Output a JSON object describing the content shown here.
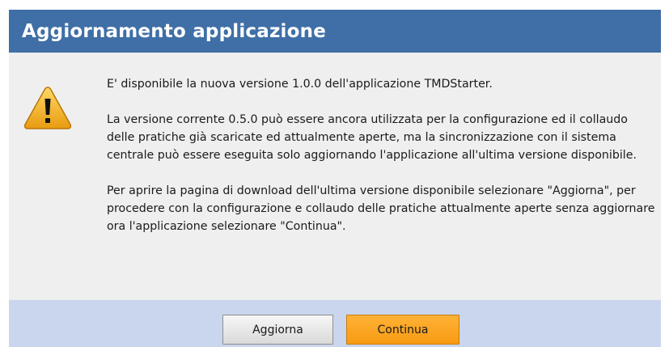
{
  "dialog": {
    "title": "Aggiornamento applicazione",
    "icon": "warning-icon",
    "paragraphs": [
      "E' disponibile la nuova versione 1.0.0 dell'applicazione TMDStarter.",
      "La versione corrente 0.5.0 può essere ancora utilizzata per la configurazione ed il collaudo delle pratiche già scaricate ed attualmente aperte, ma la sincronizzazione con il sistema centrale può essere eseguita solo aggiornando l'applicazione all'ultima versione disponibile.",
      "Per aprire la pagina di download dell'ultima versione disponibile selezionare \"Aggiorna\", per procedere con la configurazione e collaudo delle pratiche attualmente aperte senza aggiornare ora l'applicazione selezionare \"Continua\"."
    ],
    "buttons": {
      "update_label": "Aggiorna",
      "continue_label": "Continua"
    }
  },
  "colors": {
    "title_bar": "#3f6fa6",
    "body_background": "#efefef",
    "footer_background": "#c9d6ee",
    "continue_button": "#f79a12",
    "warning_icon": "#f2b020"
  }
}
